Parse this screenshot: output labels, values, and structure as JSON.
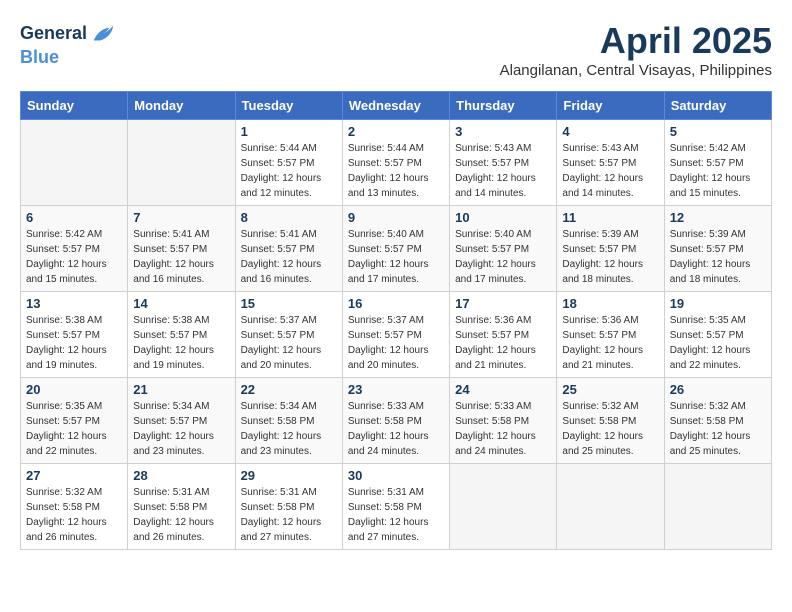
{
  "header": {
    "logo_line1": "General",
    "logo_line2": "Blue",
    "month": "April 2025",
    "location": "Alangilanan, Central Visayas, Philippines"
  },
  "weekdays": [
    "Sunday",
    "Monday",
    "Tuesday",
    "Wednesday",
    "Thursday",
    "Friday",
    "Saturday"
  ],
  "weeks": [
    [
      {
        "day": "",
        "sunrise": "",
        "sunset": "",
        "daylight": "",
        "empty": true
      },
      {
        "day": "",
        "sunrise": "",
        "sunset": "",
        "daylight": "",
        "empty": true
      },
      {
        "day": "1",
        "sunrise": "Sunrise: 5:44 AM",
        "sunset": "Sunset: 5:57 PM",
        "daylight": "Daylight: 12 hours and 12 minutes."
      },
      {
        "day": "2",
        "sunrise": "Sunrise: 5:44 AM",
        "sunset": "Sunset: 5:57 PM",
        "daylight": "Daylight: 12 hours and 13 minutes."
      },
      {
        "day": "3",
        "sunrise": "Sunrise: 5:43 AM",
        "sunset": "Sunset: 5:57 PM",
        "daylight": "Daylight: 12 hours and 14 minutes."
      },
      {
        "day": "4",
        "sunrise": "Sunrise: 5:43 AM",
        "sunset": "Sunset: 5:57 PM",
        "daylight": "Daylight: 12 hours and 14 minutes."
      },
      {
        "day": "5",
        "sunrise": "Sunrise: 5:42 AM",
        "sunset": "Sunset: 5:57 PM",
        "daylight": "Daylight: 12 hours and 15 minutes."
      }
    ],
    [
      {
        "day": "6",
        "sunrise": "Sunrise: 5:42 AM",
        "sunset": "Sunset: 5:57 PM",
        "daylight": "Daylight: 12 hours and 15 minutes."
      },
      {
        "day": "7",
        "sunrise": "Sunrise: 5:41 AM",
        "sunset": "Sunset: 5:57 PM",
        "daylight": "Daylight: 12 hours and 16 minutes."
      },
      {
        "day": "8",
        "sunrise": "Sunrise: 5:41 AM",
        "sunset": "Sunset: 5:57 PM",
        "daylight": "Daylight: 12 hours and 16 minutes."
      },
      {
        "day": "9",
        "sunrise": "Sunrise: 5:40 AM",
        "sunset": "Sunset: 5:57 PM",
        "daylight": "Daylight: 12 hours and 17 minutes."
      },
      {
        "day": "10",
        "sunrise": "Sunrise: 5:40 AM",
        "sunset": "Sunset: 5:57 PM",
        "daylight": "Daylight: 12 hours and 17 minutes."
      },
      {
        "day": "11",
        "sunrise": "Sunrise: 5:39 AM",
        "sunset": "Sunset: 5:57 PM",
        "daylight": "Daylight: 12 hours and 18 minutes."
      },
      {
        "day": "12",
        "sunrise": "Sunrise: 5:39 AM",
        "sunset": "Sunset: 5:57 PM",
        "daylight": "Daylight: 12 hours and 18 minutes."
      }
    ],
    [
      {
        "day": "13",
        "sunrise": "Sunrise: 5:38 AM",
        "sunset": "Sunset: 5:57 PM",
        "daylight": "Daylight: 12 hours and 19 minutes."
      },
      {
        "day": "14",
        "sunrise": "Sunrise: 5:38 AM",
        "sunset": "Sunset: 5:57 PM",
        "daylight": "Daylight: 12 hours and 19 minutes."
      },
      {
        "day": "15",
        "sunrise": "Sunrise: 5:37 AM",
        "sunset": "Sunset: 5:57 PM",
        "daylight": "Daylight: 12 hours and 20 minutes."
      },
      {
        "day": "16",
        "sunrise": "Sunrise: 5:37 AM",
        "sunset": "Sunset: 5:57 PM",
        "daylight": "Daylight: 12 hours and 20 minutes."
      },
      {
        "day": "17",
        "sunrise": "Sunrise: 5:36 AM",
        "sunset": "Sunset: 5:57 PM",
        "daylight": "Daylight: 12 hours and 21 minutes."
      },
      {
        "day": "18",
        "sunrise": "Sunrise: 5:36 AM",
        "sunset": "Sunset: 5:57 PM",
        "daylight": "Daylight: 12 hours and 21 minutes."
      },
      {
        "day": "19",
        "sunrise": "Sunrise: 5:35 AM",
        "sunset": "Sunset: 5:57 PM",
        "daylight": "Daylight: 12 hours and 22 minutes."
      }
    ],
    [
      {
        "day": "20",
        "sunrise": "Sunrise: 5:35 AM",
        "sunset": "Sunset: 5:57 PM",
        "daylight": "Daylight: 12 hours and 22 minutes."
      },
      {
        "day": "21",
        "sunrise": "Sunrise: 5:34 AM",
        "sunset": "Sunset: 5:57 PM",
        "daylight": "Daylight: 12 hours and 23 minutes."
      },
      {
        "day": "22",
        "sunrise": "Sunrise: 5:34 AM",
        "sunset": "Sunset: 5:58 PM",
        "daylight": "Daylight: 12 hours and 23 minutes."
      },
      {
        "day": "23",
        "sunrise": "Sunrise: 5:33 AM",
        "sunset": "Sunset: 5:58 PM",
        "daylight": "Daylight: 12 hours and 24 minutes."
      },
      {
        "day": "24",
        "sunrise": "Sunrise: 5:33 AM",
        "sunset": "Sunset: 5:58 PM",
        "daylight": "Daylight: 12 hours and 24 minutes."
      },
      {
        "day": "25",
        "sunrise": "Sunrise: 5:32 AM",
        "sunset": "Sunset: 5:58 PM",
        "daylight": "Daylight: 12 hours and 25 minutes."
      },
      {
        "day": "26",
        "sunrise": "Sunrise: 5:32 AM",
        "sunset": "Sunset: 5:58 PM",
        "daylight": "Daylight: 12 hours and 25 minutes."
      }
    ],
    [
      {
        "day": "27",
        "sunrise": "Sunrise: 5:32 AM",
        "sunset": "Sunset: 5:58 PM",
        "daylight": "Daylight: 12 hours and 26 minutes."
      },
      {
        "day": "28",
        "sunrise": "Sunrise: 5:31 AM",
        "sunset": "Sunset: 5:58 PM",
        "daylight": "Daylight: 12 hours and 26 minutes."
      },
      {
        "day": "29",
        "sunrise": "Sunrise: 5:31 AM",
        "sunset": "Sunset: 5:58 PM",
        "daylight": "Daylight: 12 hours and 27 minutes."
      },
      {
        "day": "30",
        "sunrise": "Sunrise: 5:31 AM",
        "sunset": "Sunset: 5:58 PM",
        "daylight": "Daylight: 12 hours and 27 minutes."
      },
      {
        "day": "",
        "sunrise": "",
        "sunset": "",
        "daylight": "",
        "empty": true
      },
      {
        "day": "",
        "sunrise": "",
        "sunset": "",
        "daylight": "",
        "empty": true
      },
      {
        "day": "",
        "sunrise": "",
        "sunset": "",
        "daylight": "",
        "empty": true
      }
    ]
  ]
}
